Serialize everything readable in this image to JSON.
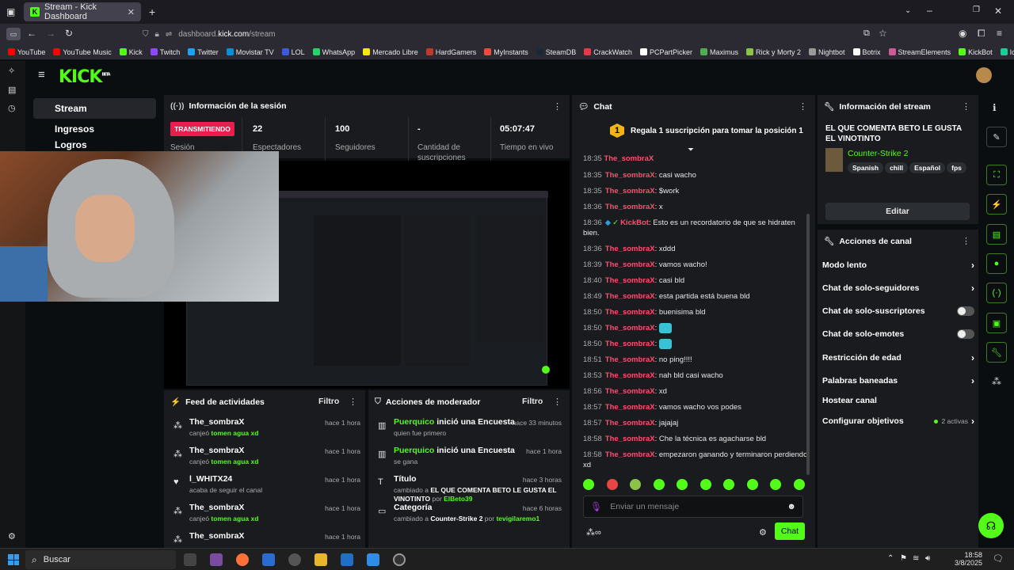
{
  "browser": {
    "tab_title": "Stream - Kick Dashboard",
    "url_prefix": "dashboard.",
    "url_domain": "kick.com",
    "url_path": "/stream",
    "bookmarks": [
      "YouTube",
      "YouTube Music",
      "Kick",
      "Twitch",
      "Twitter",
      "Movistar TV",
      "LOL",
      "WhatsApp",
      "Mercado Libre",
      "HardGamers",
      "MyInstants",
      "SteamDB",
      "CrackWatch",
      "PCPartPicker",
      "Maximus",
      "Rick y Morty 2",
      "Nightbot",
      "Botrix",
      "StreamElements",
      "KickBot",
      "Iconos vectoriales y sti..."
    ]
  },
  "app": {
    "logo": "KICK",
    "logo_badge": "BETA",
    "nav": [
      "Stream",
      "Ingresos",
      "Logros"
    ]
  },
  "session": {
    "title": "Información de la sesión",
    "status": "TRANSMITIENDO",
    "status_label": "Sesión",
    "stats": [
      {
        "value": "22",
        "label": "Espectadores"
      },
      {
        "value": "100",
        "label": "Seguidores"
      },
      {
        "value": "-",
        "label": "Cantidad de suscripciones"
      },
      {
        "value": "05:07:47",
        "label": "Tiempo en vivo"
      }
    ]
  },
  "feed": {
    "title": "Feed de actividades",
    "filter": "Filtro",
    "items": [
      {
        "name": "The_sombraX",
        "pre": "canjeó ",
        "hl": "tomen agua xd",
        "post": "",
        "time": "hace 1 hora",
        "icon": "redeem-icon"
      },
      {
        "name": "The_sombraX",
        "pre": "canjeó ",
        "hl": "tomen agua xd",
        "post": "",
        "time": "hace 1 hora",
        "icon": "redeem-icon"
      },
      {
        "name": "l_WHITX24",
        "pre": "acaba de seguir el canal",
        "hl": "",
        "post": "",
        "time": "hace 1 hora",
        "icon": "heart-icon"
      },
      {
        "name": "The_sombraX",
        "pre": "canjeó ",
        "hl": "tomen agua xd",
        "post": "",
        "time": "hace 1 hora",
        "icon": "redeem-icon"
      },
      {
        "name": "The_sombraX",
        "pre": "",
        "hl": "",
        "post": "",
        "time": "hace 1 hora",
        "icon": "redeem-icon"
      }
    ]
  },
  "mod": {
    "title": "Acciones de moderador",
    "filter": "Filtro",
    "items": [
      {
        "title_hl": "Puerquico",
        "title_rest": " inició una Encuesta",
        "sub_pre": "quien fue primero",
        "sub_hl": "",
        "sub_mid": "",
        "sub_hl2": "",
        "time": "hace 33 minutos"
      },
      {
        "title_hl": "Puerquico",
        "title_rest": " inició una Encuesta",
        "sub_pre": "se gana",
        "sub_hl": "",
        "sub_mid": "",
        "sub_hl2": "",
        "time": "hace 1 hora"
      },
      {
        "title_hl": "",
        "title_rest": "Título",
        "sub_pre": "cambiado a ",
        "sub_hl": "EL QUE COMENTA BETO LE GUSTA EL VINOTINTO",
        "sub_mid": " por ",
        "sub_hl2": "ElBeto39",
        "time": "hace 3 horas"
      },
      {
        "title_hl": "",
        "title_rest": "Categoría",
        "sub_pre": "cambiado a ",
        "sub_hl": "Counter-Strike 2",
        "sub_mid": " por ",
        "sub_hl2": "tevigilaremo1",
        "time": "hace 6 horas"
      }
    ]
  },
  "chat": {
    "title": "Chat",
    "promo": "Regala 1 suscripción para tomar la posición 1",
    "promo_rank": "1",
    "messages": [
      {
        "t": "18:35",
        "u": "The_sombraX",
        "m": "casi wacho"
      },
      {
        "t": "18:35",
        "u": "The_sombraX",
        "m": "$work"
      },
      {
        "t": "18:36",
        "u": "The_sombraX",
        "m": "x"
      },
      {
        "t": "18:36",
        "u": "KickBot",
        "m": "Esto es un recordatorio de que se hidraten bien."
      },
      {
        "t": "18:36",
        "u": "The_sombraX",
        "m": "xddd"
      },
      {
        "t": "18:39",
        "u": "The_sombraX",
        "m": "vamos wacho!"
      },
      {
        "t": "18:40",
        "u": "The_sombraX",
        "m": "casi bld"
      },
      {
        "t": "18:49",
        "u": "The_sombraX",
        "m": "esta partida está buena bld"
      },
      {
        "t": "18:50",
        "u": "The_sombraX",
        "m": "buenisima bld"
      },
      {
        "t": "18:50",
        "u": "The_sombraX",
        "m": ""
      },
      {
        "t": "18:50",
        "u": "The_sombraX",
        "m": ""
      },
      {
        "t": "18:51",
        "u": "The_sombraX",
        "m": "no ping!!!!"
      },
      {
        "t": "18:53",
        "u": "The_sombraX",
        "m": "nah bld casi wacho"
      },
      {
        "t": "18:56",
        "u": "The_sombraX",
        "m": "xd"
      },
      {
        "t": "18:57",
        "u": "The_sombraX",
        "m": "vamos wacho vos podes"
      },
      {
        "t": "18:57",
        "u": "The_sombraX",
        "m": "jajajaj"
      },
      {
        "t": "18:58",
        "u": "The_sombraX",
        "m": "Che la técnica es agacharse bld"
      },
      {
        "t": "18:58",
        "u": "The_sombraX",
        "m": "empezaron ganando y terminaron perdiendo xd"
      }
    ],
    "placeholder": "Enviar un mensaje",
    "send": "Chat",
    "top_time": "18:35"
  },
  "stream_info": {
    "title": "Información del stream",
    "stream_title": "EL QUE COMENTA BETO LE GUSTA EL VINOTINTO",
    "category": "Counter-Strike 2",
    "tags": [
      "Spanish",
      "chill",
      "Español",
      "fps"
    ],
    "edit": "Editar"
  },
  "channel_actions": {
    "title": "Acciones de canal",
    "items": [
      {
        "label": "Modo lento",
        "kind": "chevron"
      },
      {
        "label": "Chat de solo-seguidores",
        "kind": "chevron"
      },
      {
        "label": "Chat de solo-suscriptores",
        "kind": "toggle"
      },
      {
        "label": "Chat de solo-emotes",
        "kind": "toggle"
      },
      {
        "label": "Restricción de edad",
        "kind": "chevron"
      },
      {
        "label": "Palabras baneadas",
        "kind": "chevron"
      },
      {
        "label": "Hostear canal",
        "kind": "none"
      },
      {
        "label": "Configurar objetivos",
        "kind": "chevron"
      }
    ],
    "goals_active": "2 activas"
  },
  "taskbar": {
    "search": "Buscar",
    "time": "18:58",
    "date": "3/8/2025"
  },
  "colors": {
    "accent": "#53fc18",
    "live": "#e91e4d",
    "username": "#ff4e6e"
  }
}
